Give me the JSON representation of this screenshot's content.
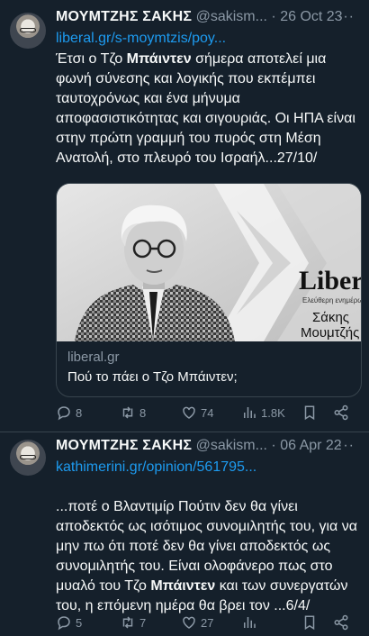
{
  "tweets": [
    {
      "name": "ΜΟΥΜΤΖΗΣ ΣΑΚΗΣ",
      "handle": "@sakism...",
      "dot": "·",
      "date": "26 Oct 23",
      "more": "···",
      "link": "liberal.gr/s-moymtzis/poy...",
      "text_before": "Έτσι ο Τζο ",
      "text_bold": "Μπάιντεν",
      "text_after": " σήμερα αποτελεί μια φωνή σύνεσης και λογικής που εκπέμπει ταυτοχρόνως και ένα μήνυμα αποφασιστικότητας και σιγουριάς. Οι ΗΠΑ είναι στην πρώτη γραμμή του πυρός στη Μέση Ανατολή, στο πλευρό του Ισραήλ...27/10/",
      "card": {
        "logo": "Liberal",
        "logo_tagline": "Ελεύθερη ενημέρωση",
        "author_first": "Σάκης",
        "author_last": "Μουμτζής",
        "domain": "liberal.gr",
        "title": "Πού το πάει ο Τζο Μπάιντεν;"
      },
      "actions": {
        "replies": "8",
        "retweets": "8",
        "likes": "74",
        "views": "1.8K"
      }
    },
    {
      "name": "ΜΟΥΜΤΖΗΣ ΣΑΚΗΣ",
      "handle": "@sakism...",
      "dot": "·",
      "date": "06 Apr 22",
      "more": "···",
      "link": "kathimerini.gr/opinion/561795...",
      "text_before": "...ποτέ ο Βλαντιμίρ Πούτιν δεν θα γίνει αποδεκτός ως ισότιμος συνομιλητής του, για να μην πω ότι ποτέ δεν θα γίνει αποδεκτός ως συνομιλητής του. Είναι ολοφάνερο πως στο μυαλό του Τζο ",
      "text_bold": "Μπάιντεν",
      "text_after": " και των συνεργατών του, η επόμενη ημέρα θα βρει τον ...6/4/",
      "actions": {
        "replies": "5",
        "retweets": "7",
        "likes": "27",
        "views": ""
      }
    }
  ],
  "colors": {
    "background": "#15202b",
    "link": "#1d9bf0",
    "muted": "#8b98a5",
    "divider": "#38444d"
  }
}
